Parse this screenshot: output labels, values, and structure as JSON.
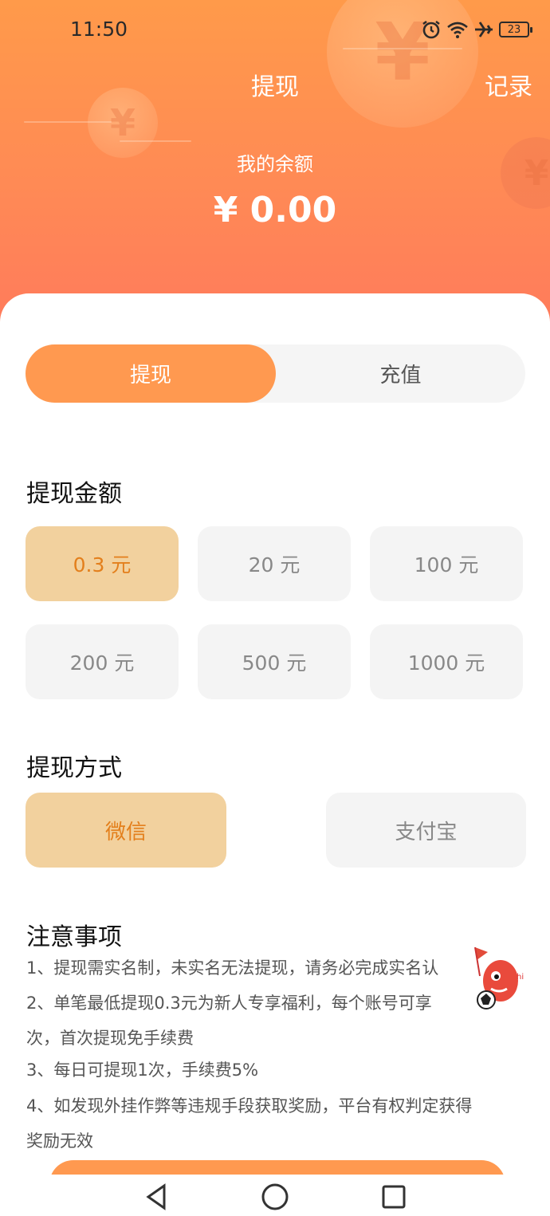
{
  "status_bar": {
    "time": "11:50",
    "battery": "23"
  },
  "header": {
    "title": "提现",
    "records": "记录",
    "balance_label": "我的余额",
    "balance": "¥ 0.00"
  },
  "tabs": {
    "withdraw": "提现",
    "recharge": "充值"
  },
  "amount_section": {
    "title": "提现金额",
    "options": [
      "0.3 元",
      "20 元",
      "100 元",
      "200 元",
      "500 元",
      "1000 元"
    ],
    "selected": "0.3 元"
  },
  "method_section": {
    "title": "提现方式",
    "options": [
      "微信",
      "支付宝"
    ],
    "selected": "微信"
  },
  "notice": {
    "title": "注意事项",
    "lines": [
      "1、提现需实名制，未实名无法提现，请务必完成实名认",
      "2、单笔最低提现0.3元为新人专享福利，每个账号可享",
      "次，首次提现免手续费",
      "3、每日可提现1次，手续费5%",
      "4、如发现外挂作弊等违规手段获取奖励，平台有权判定获得",
      "奖励无效"
    ]
  },
  "colors": {
    "accent": "#ff9950",
    "selected_bg": "#f2d19e",
    "selected_text": "#e37f1c"
  }
}
